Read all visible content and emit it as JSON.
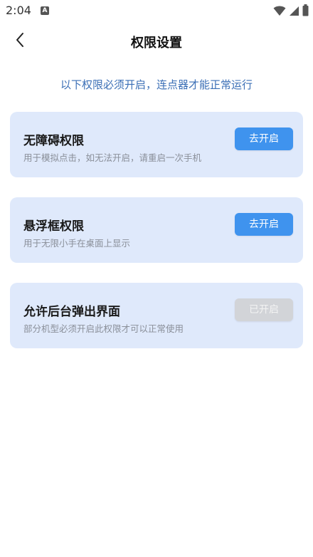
{
  "status_bar": {
    "time": "2:04",
    "notification_icon": "a-icon"
  },
  "header": {
    "back_icon": "chevron-left-icon",
    "title": "权限设置"
  },
  "notice": "以下权限必须开启，连点器才能正常运行",
  "permissions": [
    {
      "title": "无障碍权限",
      "description": "用于模拟点击，如无法开启，请重启一次手机",
      "button_label": "去开启",
      "enabled": false
    },
    {
      "title": "悬浮框权限",
      "description": "用于无限小手在桌面上显示",
      "button_label": "去开启",
      "enabled": false
    },
    {
      "title": "允许后台弹出界面",
      "description": "部分机型必须开启此权限才可以正常使用",
      "button_label": "已开启",
      "enabled": true
    }
  ],
  "colors": {
    "accent": "#3f93ee",
    "card_bg": "#dfe9fb",
    "notice_text": "#3b6fb6",
    "disabled_button": "#d2d4d8"
  }
}
